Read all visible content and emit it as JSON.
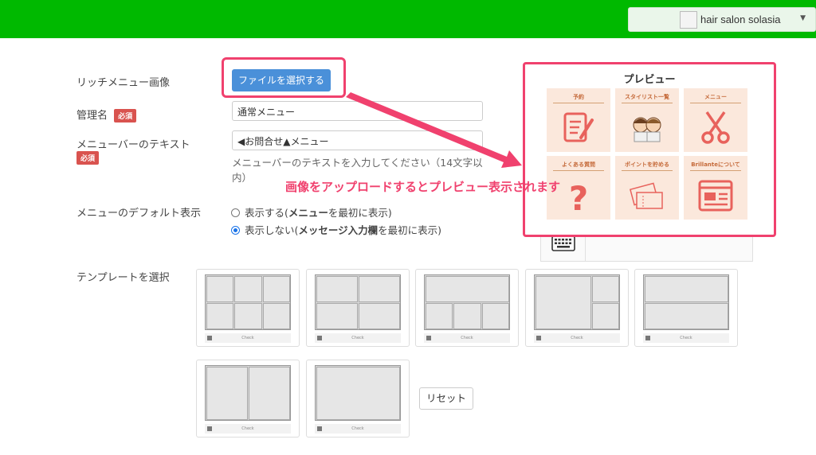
{
  "header": {
    "account_name": "hair salon solasia"
  },
  "form": {
    "rich_menu_image_label": "リッチメニュー画像",
    "file_button_label": "ファイルを選択する",
    "admin_name_label": "管理名",
    "required_badge": "必須",
    "admin_name_value": "通常メニュー",
    "menubar_text_label": "メニューバーのテキスト",
    "menubar_text_value": "◀お問合せ▲メニュー",
    "menubar_help": "メニューバーのテキストを入力してください（14文字以内）",
    "default_display_label": "メニューのデフォルト表示",
    "radio_show": {
      "prefix": "表示する(",
      "bold": "メニュー",
      "suffix": "を最初に表示)"
    },
    "radio_hide": {
      "prefix": "表示しない(",
      "bold": "メッセージ入力欄",
      "suffix": "を最初に表示)"
    },
    "template_label": "テンプレートを選択",
    "reset_label": "リセット"
  },
  "preview": {
    "title": "プレビュー",
    "tiles": [
      {
        "label": "予約",
        "icon": "clipboard-pen-icon"
      },
      {
        "label": "スタイリスト一覧",
        "icon": "stylists-icon"
      },
      {
        "label": "メニュー",
        "icon": "scissors-icon"
      },
      {
        "label": "よくある質問",
        "icon": "question-icon"
      },
      {
        "label": "ポイントを貯める",
        "icon": "cards-icon"
      },
      {
        "label": "Brillanteについて",
        "icon": "webpage-icon"
      }
    ]
  },
  "annotation": {
    "arrow_text": "画像をアップロードするとプレビュー表示されます",
    "color": "#f0416e"
  },
  "templates": {
    "footer_text": "Check",
    "items": [
      "template-6-grid",
      "template-4-grid",
      "template-1-3",
      "template-1-2",
      "template-2-rows",
      "template-2-cols",
      "template-1"
    ]
  },
  "colors": {
    "brand_green": "#00b900",
    "button_blue": "#4a90d9",
    "required_red": "#d9534f"
  }
}
